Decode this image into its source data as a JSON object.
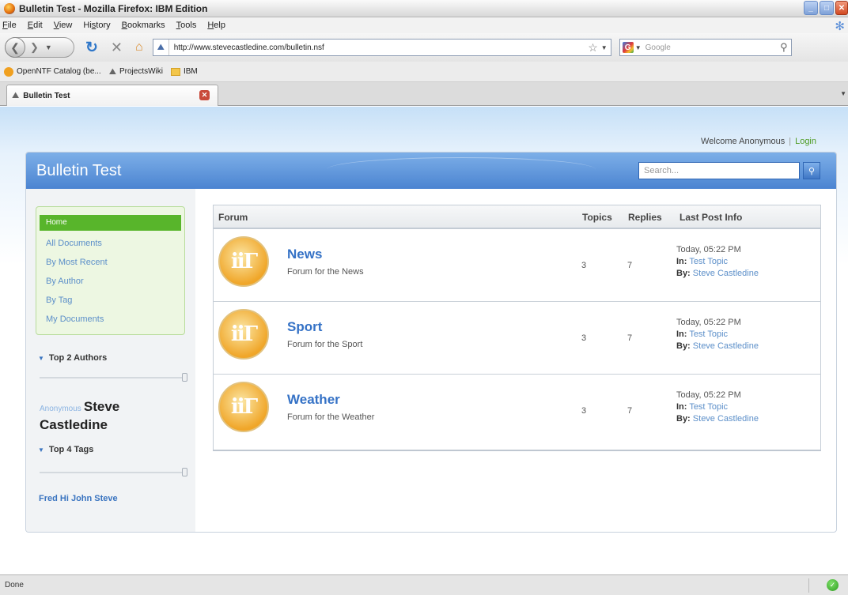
{
  "window": {
    "title": "Bulletin Test - Mozilla Firefox: IBM Edition"
  },
  "menu": [
    "File",
    "Edit",
    "View",
    "History",
    "Bookmarks",
    "Tools",
    "Help"
  ],
  "menu_underlines": [
    "F",
    "E",
    "V",
    "s",
    "B",
    "T",
    "H"
  ],
  "nav": {
    "url": "http://www.stevecastledine.com/bulletin.nsf",
    "search_placeholder": "Google"
  },
  "bookmarks": [
    "OpenNTF Catalog (be...",
    "ProjectsWiki",
    "IBM"
  ],
  "tab": {
    "label": "Bulletin Test"
  },
  "page": {
    "welcome": "Welcome Anonymous",
    "login": "Login",
    "separator": "|",
    "app_title": "Bulletin Test",
    "search_placeholder": "Search..."
  },
  "sidebar": {
    "home": "Home",
    "links": [
      "All Documents",
      "By Most Recent",
      "By Author",
      "By Tag",
      "My Documents"
    ],
    "authors_heading": "Top 2 Authors",
    "authors": {
      "small": "Anonymous",
      "big": "Steve Castledine"
    },
    "tags_heading": "Top 4 Tags",
    "tags": "Fred Hi John Steve"
  },
  "forum": {
    "headers": {
      "forum": "Forum",
      "topics": "Topics",
      "replies": "Replies",
      "last_post": "Last Post Info"
    },
    "rows": [
      {
        "name": "News",
        "desc": "Forum for the News",
        "topics": "3",
        "replies": "7",
        "date": "Today, 05:22 PM",
        "in_label": "In:",
        "in_topic": "Test Topic",
        "by_label": "By:",
        "by_author": "Steve Castledine"
      },
      {
        "name": "Sport",
        "desc": "Forum for the Sport",
        "topics": "3",
        "replies": "7",
        "date": "Today, 05:22 PM",
        "in_label": "In:",
        "in_topic": "Test Topic",
        "by_label": "By:",
        "by_author": "Steve Castledine"
      },
      {
        "name": "Weather",
        "desc": "Forum for the Weather",
        "topics": "3",
        "replies": "7",
        "date": "Today, 05:22 PM",
        "in_label": "In:",
        "in_topic": "Test Topic",
        "by_label": "By:",
        "by_author": "Steve Castledine"
      }
    ]
  },
  "status": {
    "text": "Done"
  },
  "colors": {
    "header_blue": "#4b84d1",
    "menu_green": "#58b52b",
    "link_blue": "#5c8fc9",
    "login_green": "#4e9b22"
  }
}
